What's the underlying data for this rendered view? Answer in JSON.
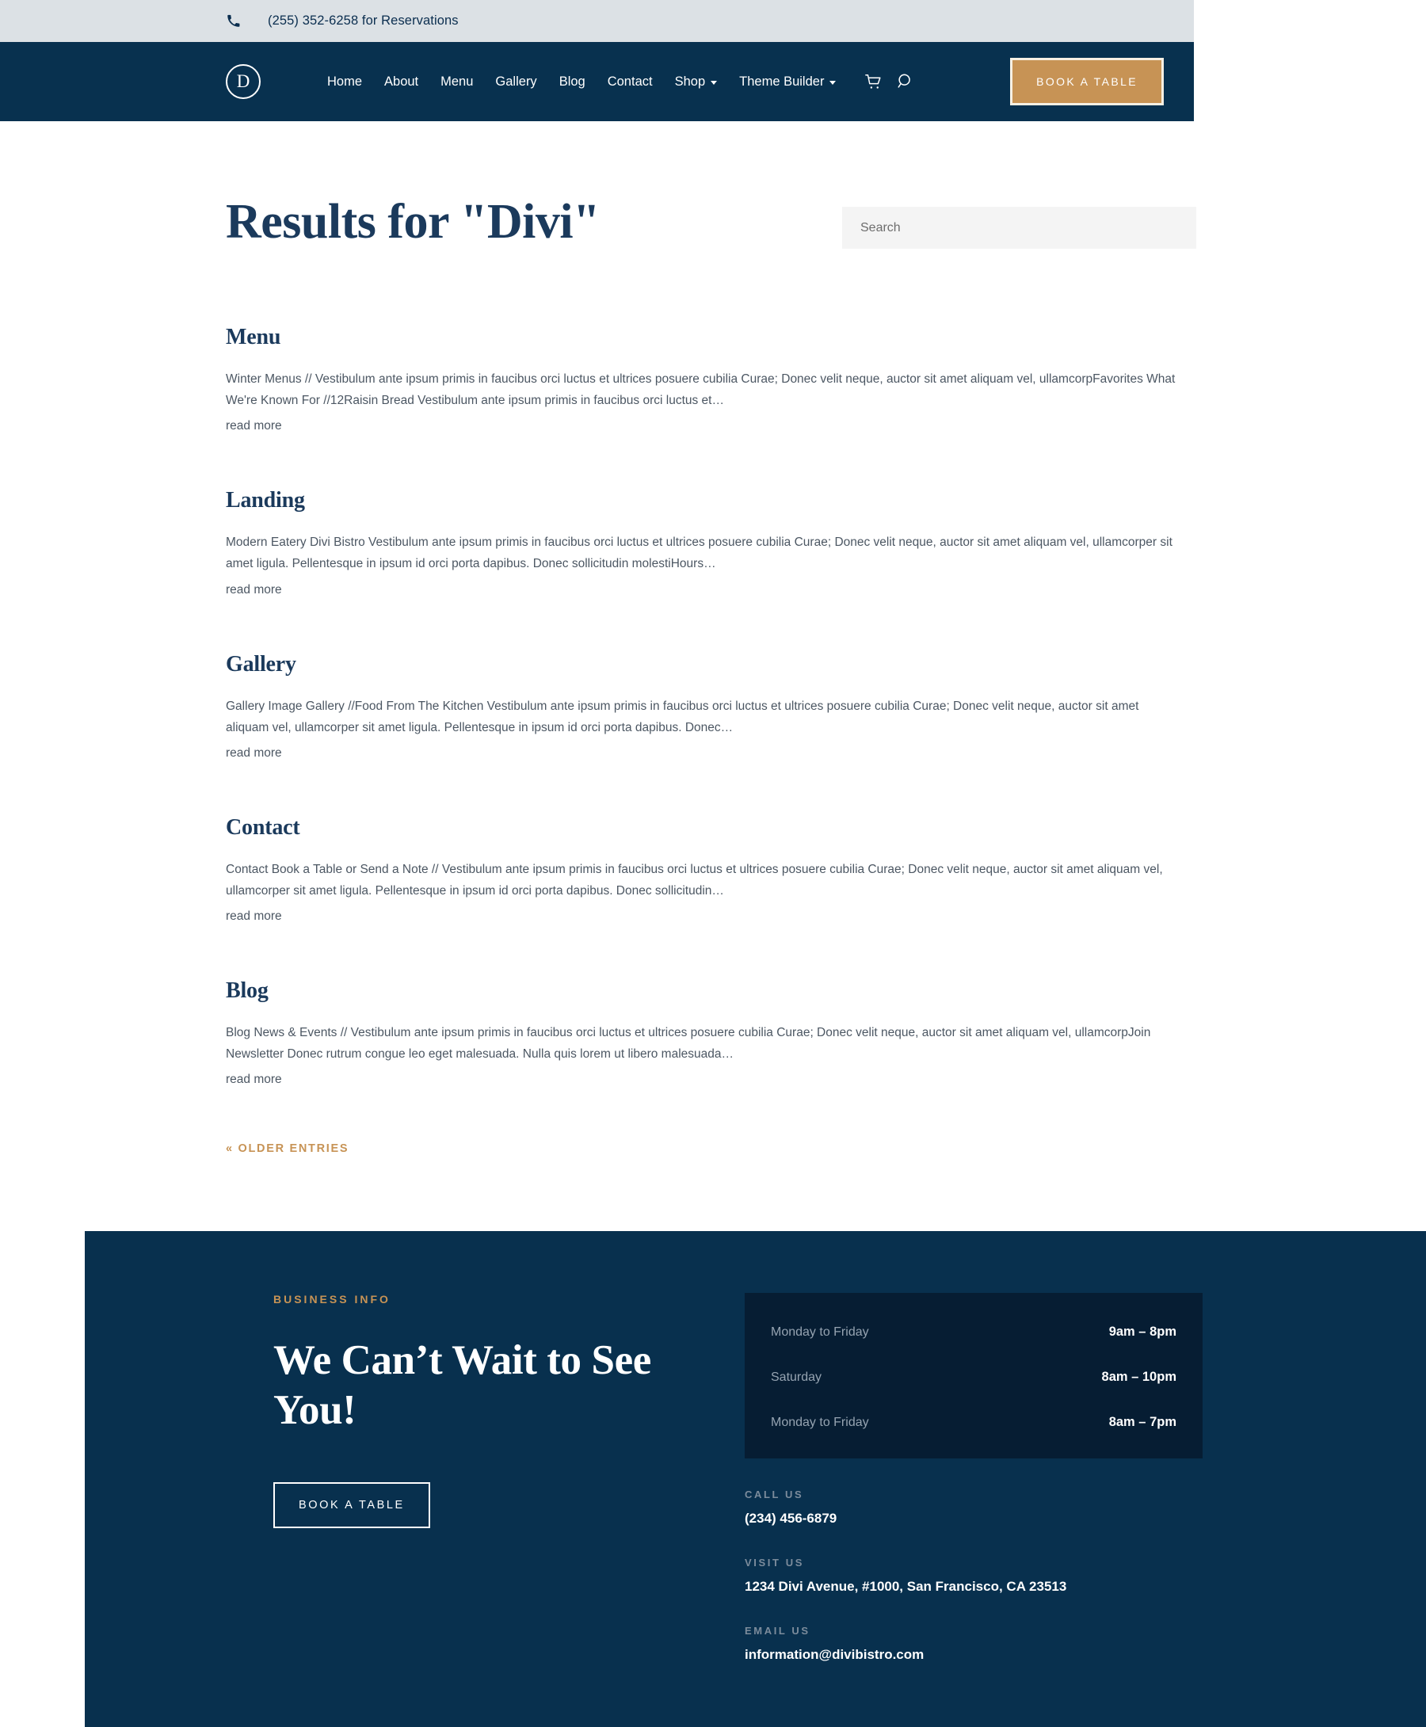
{
  "topbar": {
    "phone_icon": "phone-icon",
    "text": "(255) 352-6258 for Reservations"
  },
  "nav": {
    "logo_letter": "D",
    "items": [
      {
        "label": "Home",
        "has_dropdown": false
      },
      {
        "label": "About",
        "has_dropdown": false
      },
      {
        "label": "Menu",
        "has_dropdown": false
      },
      {
        "label": "Gallery",
        "has_dropdown": false
      },
      {
        "label": "Blog",
        "has_dropdown": false
      },
      {
        "label": "Contact",
        "has_dropdown": false
      },
      {
        "label": "Shop",
        "has_dropdown": true
      },
      {
        "label": "Theme Builder",
        "has_dropdown": true
      }
    ],
    "icons": [
      "cart-icon",
      "search-icon"
    ],
    "cta_label": "BOOK A TABLE"
  },
  "main": {
    "title": "Results for \"Divi\"",
    "search_placeholder": "Search",
    "search_value": "",
    "results": [
      {
        "title": "Menu",
        "excerpt": "Winter Menus // Vestibulum ante ipsum primis in faucibus orci luctus et ultrices posuere cubilia Curae; Donec velit neque, auctor sit amet aliquam vel, ullamcorpFavorites What We're Known For //12Raisin Bread Vestibulum ante ipsum primis in faucibus orci luctus et…",
        "read_more": "read more"
      },
      {
        "title": "Landing",
        "excerpt": "Modern Eatery Divi Bistro Vestibulum ante ipsum primis in faucibus orci luctus et ultrices posuere cubilia Curae; Donec velit neque, auctor sit amet aliquam vel, ullamcorper sit amet ligula. Pellentesque in ipsum id orci porta dapibus. Donec sollicitudin molestiHours…",
        "read_more": "read more"
      },
      {
        "title": "Gallery",
        "excerpt": "Gallery Image Gallery //Food From The Kitchen Vestibulum ante ipsum primis in faucibus orci luctus et ultrices posuere cubilia Curae; Donec velit neque, auctor sit amet aliquam vel, ullamcorper sit amet ligula. Pellentesque in ipsum id orci porta dapibus. Donec…",
        "read_more": "read more"
      },
      {
        "title": "Contact",
        "excerpt": "Contact Book a Table or Send a Note // Vestibulum ante ipsum primis in faucibus orci luctus et ultrices posuere cubilia Curae; Donec velit neque, auctor sit amet aliquam vel, ullamcorper sit amet ligula. Pellentesque in ipsum id orci porta dapibus. Donec sollicitudin…",
        "read_more": "read more"
      },
      {
        "title": "Blog",
        "excerpt": "Blog News & Events // Vestibulum ante ipsum primis in faucibus orci luctus et ultrices posuere cubilia Curae; Donec velit neque, auctor sit amet aliquam vel, ullamcorpJoin Newsletter Donec rutrum congue leo eget malesuada. Nulla quis lorem ut libero malesuada…",
        "read_more": "read more"
      }
    ],
    "pagination_label": "« OLDER ENTRIES"
  },
  "footer": {
    "eyebrow": "BUSINESS INFO",
    "heading": "We Can’t Wait to See You!",
    "cta_label": "BOOK A TABLE",
    "hours": [
      {
        "day": "Monday to Friday",
        "time": "9am – 8pm"
      },
      {
        "day": "Saturday",
        "time": "8am – 10pm"
      },
      {
        "day": "Monday to Friday",
        "time": "8am – 7pm"
      }
    ],
    "contact": [
      {
        "label": "CALL US",
        "value": "(234) 456-6879"
      },
      {
        "label": "VISIT US",
        "value": "1234 Divi Avenue, #1000, San Francisco, CA 23513"
      },
      {
        "label": "EMAIL US",
        "value": "information@divibistro.com"
      }
    ]
  },
  "colors": {
    "navy": "#08314f",
    "topbar_grey": "#dce1e5",
    "gold": "#c79355",
    "heading_navy": "#1b3a5c",
    "hours_box": "#061d33",
    "body_text": "#4c5763"
  }
}
